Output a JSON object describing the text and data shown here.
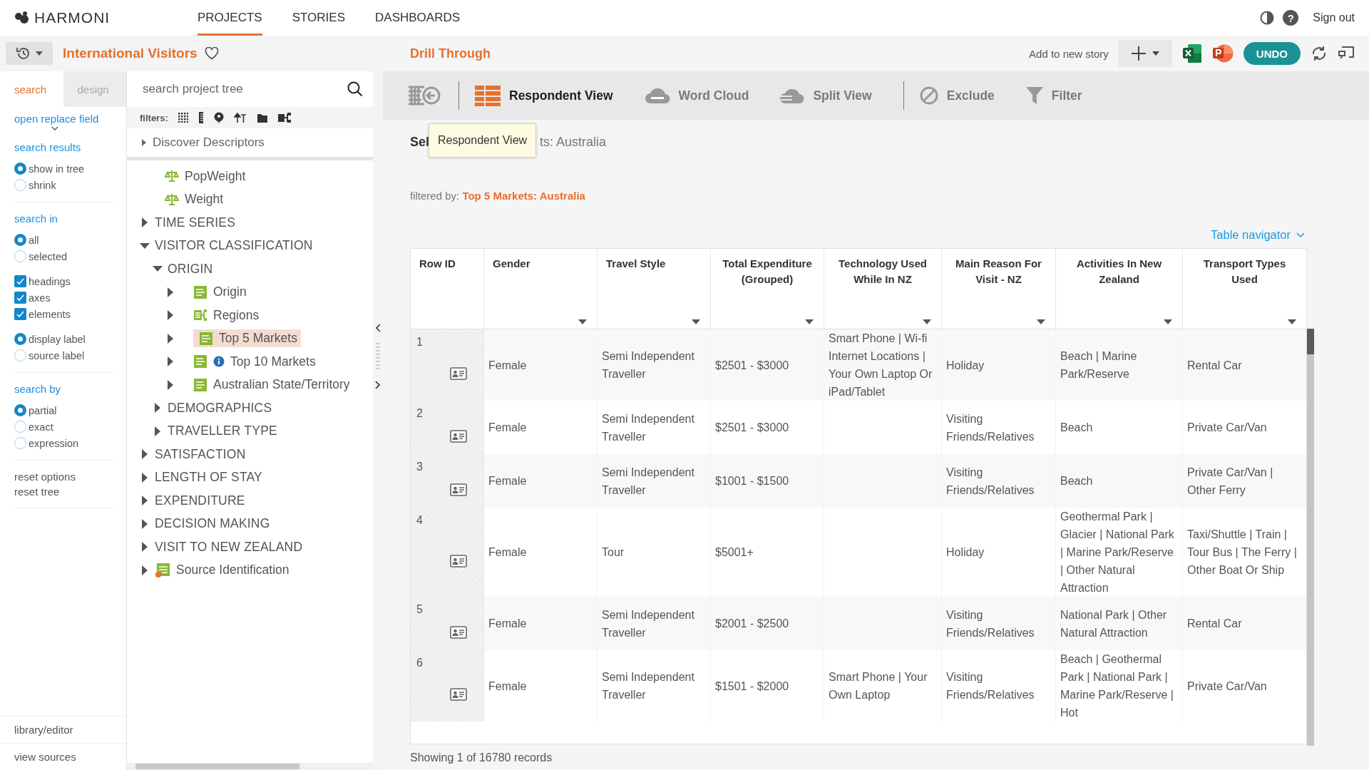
{
  "brand": "HARMONI",
  "nav": [
    {
      "label": "PROJECTS",
      "selected": true
    },
    {
      "label": "STORIES",
      "selected": false
    },
    {
      "label": "DASHBOARDS",
      "selected": false
    }
  ],
  "help_label": "?",
  "sign_out": "Sign out",
  "project": {
    "title": "International Visitors",
    "favorite": false
  },
  "panel_tabs": [
    {
      "label": "search",
      "selected": true
    },
    {
      "label": "design",
      "selected": false
    }
  ],
  "search": {
    "placeholder": "search project tree"
  },
  "filters_label": "filters:",
  "options": {
    "replace_link": "open replace field",
    "sections": [
      {
        "groups": [
          {
            "title": "search results",
            "kind": "radio",
            "items": [
              {
                "label": "show in tree",
                "selected": true
              },
              {
                "label": "shrink",
                "selected": false
              }
            ]
          }
        ]
      },
      {
        "groups": [
          {
            "title": "search in",
            "kind": "radio",
            "items": [
              {
                "label": "all",
                "selected": true
              },
              {
                "label": "selected",
                "selected": false
              }
            ]
          },
          {
            "kind": "checkbox",
            "items": [
              {
                "label": "headings",
                "checked": true
              },
              {
                "label": "axes",
                "checked": true
              },
              {
                "label": "elements",
                "checked": true
              }
            ]
          },
          {
            "kind": "radio",
            "items": [
              {
                "label": "display label",
                "selected": true
              },
              {
                "label": "source label",
                "selected": false
              }
            ]
          }
        ]
      },
      {
        "groups": [
          {
            "title": "search by",
            "kind": "radio",
            "items": [
              {
                "label": "partial",
                "selected": true
              },
              {
                "label": "exact",
                "selected": false
              },
              {
                "label": "expression",
                "selected": false
              }
            ]
          }
        ]
      }
    ],
    "actions": [
      "reset options",
      "reset tree"
    ],
    "footer": [
      "library/editor",
      "view sources"
    ]
  },
  "tree": {
    "header": "Discover Descriptors",
    "items": [
      {
        "label": "PopWeight",
        "kind": "weight",
        "expanded": false,
        "selected": false,
        "info": false
      },
      {
        "label": "Weight",
        "kind": "weight",
        "expanded": false,
        "selected": false,
        "info": false
      },
      {
        "label": "TIME SERIES",
        "kind": "heading",
        "expanded": false,
        "selected": false,
        "info": false
      },
      {
        "label": "VISITOR CLASSIFICATION",
        "kind": "heading",
        "expanded": true,
        "selected": false,
        "info": false,
        "children": [
          {
            "label": "ORIGIN",
            "kind": "heading",
            "expanded": true,
            "selected": false,
            "info": false,
            "children": [
              {
                "label": "Origin",
                "kind": "variable",
                "expanded": false,
                "selected": false,
                "info": false
              },
              {
                "label": "Regions",
                "kind": "hierarchy",
                "expanded": false,
                "selected": false,
                "info": false
              },
              {
                "label": "Top 5 Markets",
                "kind": "variable",
                "expanded": false,
                "selected": true,
                "info": false
              },
              {
                "label": "Top 10 Markets",
                "kind": "variable",
                "expanded": false,
                "selected": false,
                "info": true
              },
              {
                "label": "Australian State/Territory",
                "kind": "variable",
                "expanded": false,
                "selected": false,
                "info": false
              }
            ]
          },
          {
            "label": "DEMOGRAPHICS",
            "kind": "heading",
            "expanded": false,
            "selected": false,
            "info": false
          },
          {
            "label": "TRAVELLER TYPE",
            "kind": "heading",
            "expanded": false,
            "selected": false,
            "info": false
          }
        ]
      },
      {
        "label": "SATISFACTION",
        "kind": "heading",
        "expanded": false,
        "selected": false,
        "info": false
      },
      {
        "label": "LENGTH OF STAY",
        "kind": "heading",
        "expanded": false,
        "selected": false,
        "info": false
      },
      {
        "label": "EXPENDITURE",
        "kind": "heading",
        "expanded": false,
        "selected": false,
        "info": false
      },
      {
        "label": "DECISION MAKING",
        "kind": "heading",
        "expanded": false,
        "selected": false,
        "info": false
      },
      {
        "label": "VISIT TO NEW ZEALAND",
        "kind": "heading",
        "expanded": false,
        "selected": false,
        "info": false
      },
      {
        "label": "Source Identification",
        "kind": "source",
        "expanded": false,
        "selected": false,
        "info": false
      }
    ]
  },
  "view_title": "Drill Through",
  "add_to_story": "Add to new story",
  "undo": "UNDO",
  "toolbar": [
    {
      "kind": "separator"
    },
    {
      "kind": "respondent",
      "label": "Respondent View",
      "selected": true
    },
    {
      "kind": "cloud",
      "label": "Word Cloud",
      "selected": false
    },
    {
      "kind": "split",
      "label": "Split View",
      "selected": false
    },
    {
      "kind": "separator"
    },
    {
      "kind": "exclude",
      "label": "Exclude",
      "selected": false
    },
    {
      "kind": "filter",
      "label": "Filter",
      "selected": false
    }
  ],
  "tooltip": "Respondent View",
  "selection": {
    "start": "Sel",
    "end": "ts: Australia"
  },
  "filtered": {
    "label": "filtered by:",
    "value": "Top 5 Markets: Australia"
  },
  "table_navigator": "Table navigator",
  "table": {
    "columns": [
      {
        "label": "Row ID",
        "sortable": false
      },
      {
        "label": "Gender",
        "sortable": true
      },
      {
        "label": "Travel Style",
        "sortable": true
      },
      {
        "label": "Total Expenditure (Grouped)",
        "sortable": true
      },
      {
        "label": "Technology Used While In NZ",
        "sortable": true
      },
      {
        "label": "Main Reason For Visit - NZ",
        "sortable": true
      },
      {
        "label": "Activities In New Zealand",
        "sortable": true
      },
      {
        "label": "Transport Types Used",
        "sortable": true
      }
    ],
    "rows": [
      {
        "cells": [
          "1",
          "Female",
          "Semi Independent Traveller",
          "$2501 - $3000",
          "Smart Phone | Wi-fi Internet Locations | Your Own Laptop Or iPad/Tablet",
          "Holiday",
          "Beach | Marine Park/Reserve",
          "Rental Car"
        ]
      },
      {
        "cells": [
          "2",
          "Female",
          "Semi Independent Traveller",
          "$2501 - $3000",
          null,
          "Visiting Friends/Relatives",
          "Beach",
          "Private Car/Van"
        ]
      },
      {
        "cells": [
          "3",
          "Female",
          "Semi Independent Traveller",
          "$1001 - $1500",
          null,
          "Visiting Friends/Relatives",
          "Beach",
          "Private Car/Van | Other Ferry"
        ]
      },
      {
        "cells": [
          "4",
          "Female",
          "Tour",
          "$5001+",
          null,
          "Holiday",
          "Geothermal Park | Glacier | National Park | Marine Park/Reserve | Other Natural Attraction",
          "Taxi/Shuttle | Train | Tour Bus | The Ferry | Other Boat Or Ship"
        ]
      },
      {
        "cells": [
          "5",
          "Female",
          "Semi Independent Traveller",
          "$2001 - $2500",
          null,
          "Visiting Friends/Relatives",
          "National Park | Other Natural Attraction",
          "Rental Car"
        ]
      },
      {
        "cells": [
          "6",
          "Female",
          "Semi Independent Traveller",
          "$1501 - $2000",
          "Smart Phone | Your Own Laptop",
          "Visiting Friends/Relatives",
          "Beach | Geothermal Park | National Park | Marine Park/Reserve | Hot",
          "Private Car/Van"
        ]
      }
    ]
  },
  "status": "Showing 1 of 16780 records"
}
